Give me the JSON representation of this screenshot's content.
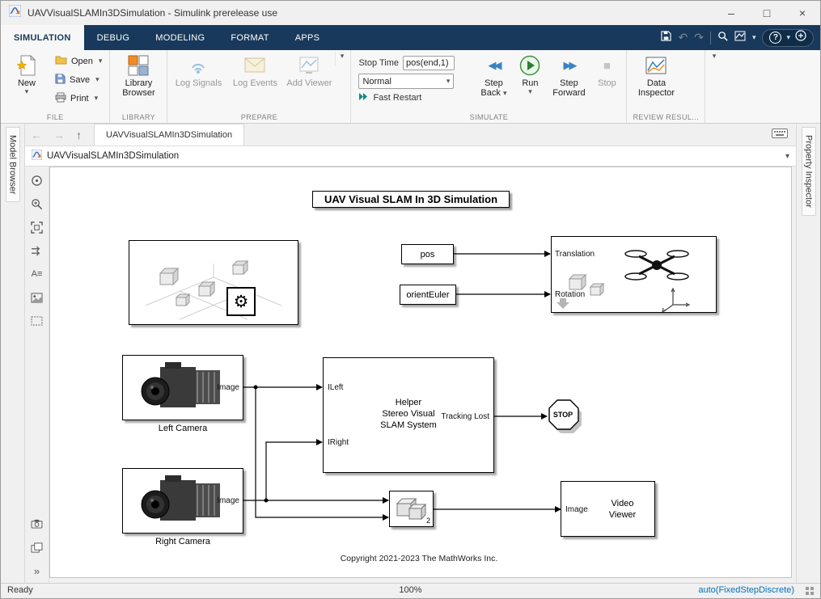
{
  "window": {
    "title": "UAVVisualSLAMIn3DSimulation - Simulink prerelease use"
  },
  "icons": {
    "minimize": "–",
    "maximize": "□",
    "close": "×",
    "chevron_down": "▾",
    "undo": "↶",
    "redo": "↷",
    "back": "←",
    "forward": "→",
    "up": "↑",
    "help": "?",
    "gear": "⚙",
    "step_back": "◀◀",
    "step_forward": "▶▶",
    "stop": "■",
    "annotation": "A≡",
    "more_chevrons": "»"
  },
  "ribbon": {
    "tabs": [
      "SIMULATION",
      "DEBUG",
      "MODELING",
      "FORMAT",
      "APPS"
    ],
    "file": {
      "new_label": "New",
      "open_label": "Open",
      "save_label": "Save",
      "print_label": "Print",
      "section_label": "FILE"
    },
    "library": {
      "browser_label": "Library Browser",
      "section_label": "LIBRARY"
    },
    "prepare": {
      "log_signals_label": "Log Signals",
      "log_events_label": "Log Events",
      "add_viewer_label": "Add Viewer",
      "section_label": "PREPARE"
    },
    "simulate": {
      "stop_time_label": "Stop Time",
      "stop_time_value": "pos(end,1)",
      "mode_value": "Normal",
      "fast_restart_label": "Fast Restart",
      "step_back_label": "Step Back",
      "run_label": "Run",
      "step_forward_label": "Step Forward",
      "stop_label": "Stop",
      "section_label": "SIMULATE"
    },
    "review": {
      "data_inspector_label": "Data Inspector",
      "section_label": "REVIEW RESUL..."
    }
  },
  "nav": {
    "doc_tab": "UAVVisualSLAMIn3DSimulation",
    "breadcrumb": "UAVVisualSLAMIn3DSimulation"
  },
  "panels": {
    "left_tab": "Model Browser",
    "right_tab": "Property Inspector"
  },
  "diagram": {
    "title": "UAV Visual SLAM In 3D Simulation",
    "copyright": "Copyright 2021-2023 The MathWorks Inc.",
    "blocks": {
      "pos": {
        "label": "pos"
      },
      "orient_euler": {
        "label": "orientEuler"
      },
      "uav_viewer": {
        "port_in1": "Translation",
        "port_in2": "Rotation"
      },
      "left_camera": {
        "caption": "Left Camera",
        "port_out": "Image"
      },
      "right_camera": {
        "caption": "Right Camera",
        "port_out": "Image"
      },
      "helper": {
        "line1": "Helper",
        "line2": "Stereo Visual",
        "line3": "SLAM System",
        "port_in1": "ILeft",
        "port_in2": "IRight",
        "port_out": "Tracking Lost"
      },
      "stop": {
        "label": "STOP"
      },
      "mux": {
        "label": "2"
      },
      "video_viewer": {
        "line1": "Video",
        "line2": "Viewer",
        "port_in": "Image"
      }
    }
  },
  "status": {
    "left": "Ready",
    "zoom": "100%",
    "right": "auto(FixedStepDiscrete)"
  },
  "colors": {
    "toolstrip_blue": "#18395b",
    "run_green": "#2e7d32",
    "step_blue": "#3b82c4",
    "link_blue": "#0072bd"
  }
}
